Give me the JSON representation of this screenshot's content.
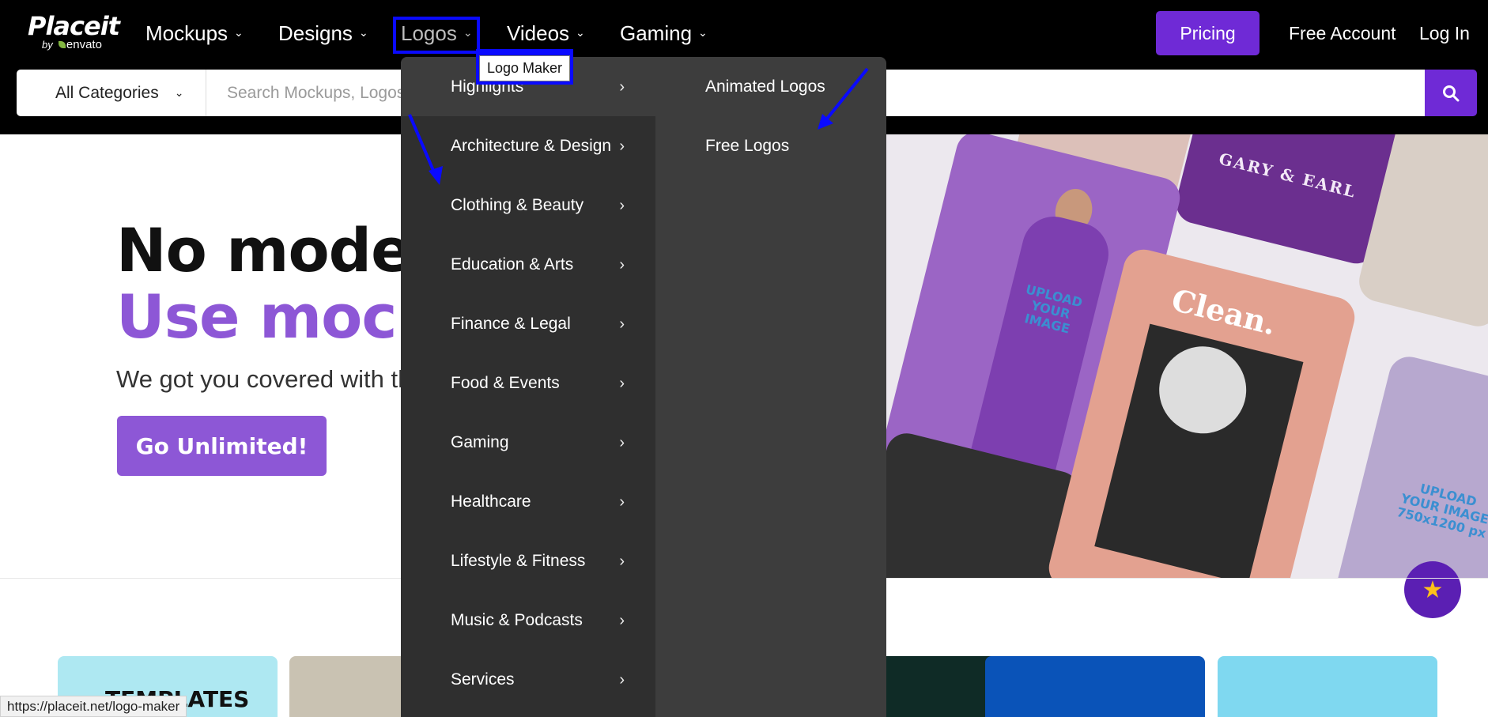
{
  "brand": {
    "name": "Placeit",
    "by": "by",
    "parent": "envato"
  },
  "nav": {
    "items": [
      {
        "label": "Mockups"
      },
      {
        "label": "Designs"
      },
      {
        "label": "Logos"
      },
      {
        "label": "Videos"
      },
      {
        "label": "Gaming"
      }
    ],
    "pricing_label": "Pricing",
    "free_account_label": "Free Account",
    "login_label": "Log In"
  },
  "search": {
    "category_label": "All Categories",
    "placeholder": "Search Mockups, Logos, Design Templates, and more"
  },
  "tooltip": {
    "text": "Logo Maker"
  },
  "dropdown": {
    "left_items": [
      {
        "label": "Highlights"
      },
      {
        "label": "Architecture & Design"
      },
      {
        "label": "Clothing & Beauty"
      },
      {
        "label": "Education & Arts"
      },
      {
        "label": "Finance & Legal"
      },
      {
        "label": "Food & Events"
      },
      {
        "label": "Gaming"
      },
      {
        "label": "Healthcare"
      },
      {
        "label": "Lifestyle & Fitness"
      },
      {
        "label": "Music & Podcasts"
      },
      {
        "label": "Services"
      }
    ],
    "right_items": [
      {
        "label": "Animated Logos"
      },
      {
        "label": "Free Logos"
      }
    ]
  },
  "hero": {
    "title_line1": "No models, no problem",
    "title_line2": "Use mockups",
    "subtitle": "We got you covered with thousands of templates",
    "cta_label": "Go Unlimited!"
  },
  "hero_art": {
    "clean_text": "Clean.",
    "couple_text": "GARY & EARL",
    "upload_text_1": "UPLOAD YOUR IMAGE",
    "upload_text_2": "UPLOAD YOUR IMAGE 750x1200 px"
  },
  "bottom_cards": [
    {
      "label": "TEMPLATES",
      "color": "#aee8f2"
    },
    {
      "label": "",
      "color": "#c9c2b2"
    },
    {
      "label": "",
      "color": "#0f2b26"
    },
    {
      "label": "",
      "color": "#0a53b8"
    },
    {
      "label": "",
      "color": "#7fd8f0"
    }
  ],
  "status_bar": {
    "url": "https://placeit.net/logo-maker"
  },
  "colors": {
    "accent": "#6f2ad6",
    "hero_purple": "#8d57d6",
    "annotation_blue": "#0a0aff"
  }
}
